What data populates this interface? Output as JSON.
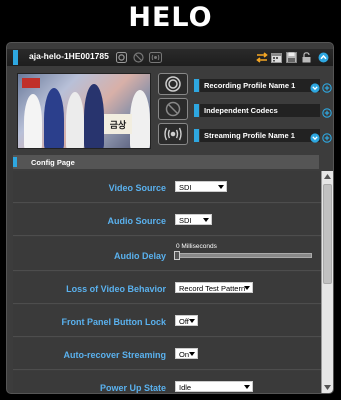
{
  "app": {
    "title": "HELO"
  },
  "device": {
    "name": "aja-helo-1HE001785"
  },
  "thumbnail": {
    "sign_text": "금상"
  },
  "profiles": {
    "recording": "Recording Profile Name 1",
    "codec": "Independent Codecs",
    "streaming": "Streaming Profile Name 1"
  },
  "config": {
    "title": "Config Page",
    "rows": [
      {
        "label": "Video Source",
        "value": "SDI"
      },
      {
        "label": "Audio Source",
        "value": "SDI"
      },
      {
        "label": "Audio Delay",
        "value": "0 Milliseconds",
        "slider_fraction": 0.0
      },
      {
        "label": "Loss of Video Behavior",
        "value": "Record Test Pattern"
      },
      {
        "label": "Front Panel Button Lock",
        "value": "Off"
      },
      {
        "label": "Auto-recover Streaming",
        "value": "On"
      },
      {
        "label": "Power Up State",
        "value": "Idle"
      }
    ]
  },
  "colors": {
    "accent": "#2ea7e0",
    "label": "#5ab1ee",
    "swap_icon": "#f5a623"
  }
}
